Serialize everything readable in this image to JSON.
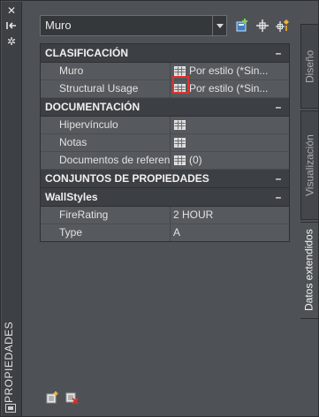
{
  "palette": "Properties",
  "side_title": "PROPIEDADES",
  "icons": {
    "close": "close-icon",
    "autohide": "autohide-icon",
    "settings": "gear-icon",
    "palette": "palette-icon"
  },
  "selector": {
    "value": "Muro"
  },
  "toolbar": [
    "add-property-icon",
    "select-objects-icon",
    "quick-select-icon"
  ],
  "categories": {
    "clasificacion": {
      "title": "CLASIFICACIÓN",
      "rows": [
        {
          "name": "Muro",
          "value": "Por estilo  (*Sin..."
        },
        {
          "name": "Structural Usage",
          "value": "Por estilo  (*Sin..."
        }
      ]
    },
    "documentacion": {
      "title": "DOCUMENTACIÓN",
      "rows": [
        {
          "name": "Hipervínculo",
          "value": ""
        },
        {
          "name": "Notas",
          "value": ""
        },
        {
          "name": "Documentos de referencia",
          "value": "(0)"
        }
      ]
    },
    "conjuntos": {
      "title": "CONJUNTOS DE PROPIEDADES"
    },
    "wallstyles": {
      "title": "WallStyles",
      "rows": [
        {
          "name": "FireRating",
          "value": "2 HOUR"
        },
        {
          "name": "Type",
          "value": "A"
        }
      ]
    }
  },
  "tabs": [
    {
      "label": "Diseño",
      "active": false
    },
    {
      "label": "Visualización",
      "active": false
    },
    {
      "label": "Datos extendidos",
      "active": true
    }
  ],
  "collapse_symbol": "–"
}
